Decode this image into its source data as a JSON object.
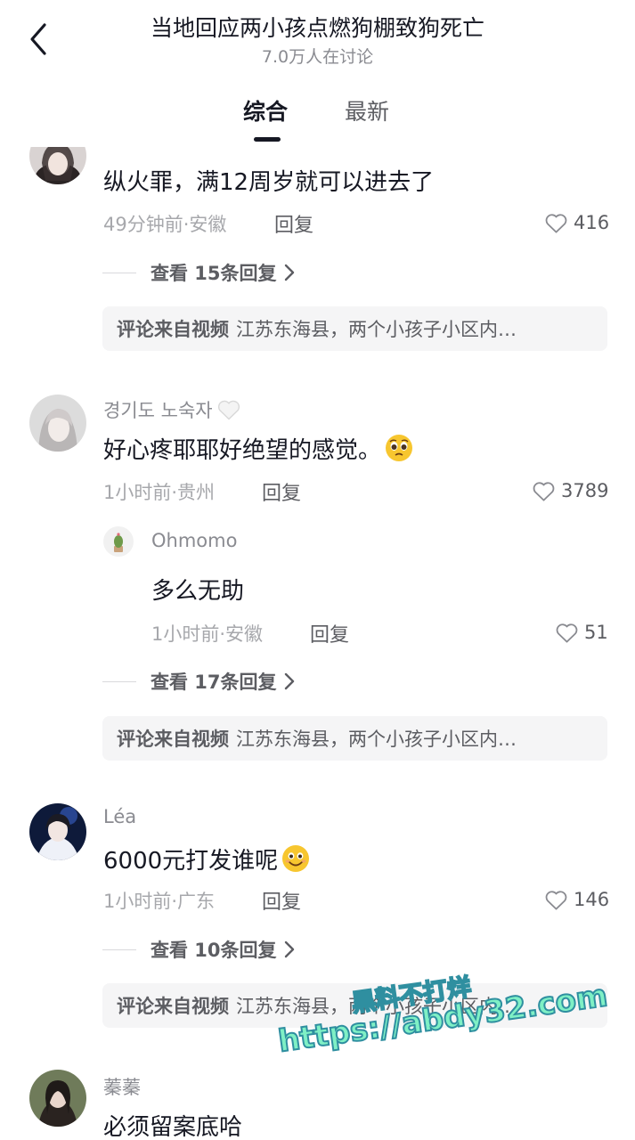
{
  "header": {
    "title": "当地回应两小孩点燃狗棚致狗死亡",
    "subtitle": "7.0万人在讨论"
  },
  "tabs": [
    {
      "label": "综合",
      "active": true
    },
    {
      "label": "最新",
      "active": false
    }
  ],
  "comments": [
    {
      "text": "纵火罪，满12周岁就可以进去了",
      "time_location": "49分钟前·安徽",
      "reply_label": "回复",
      "likes": "416",
      "view_replies": "查看 15条回复",
      "source_label": "评论来自视频",
      "source_text": "江苏东海县，两个小孩子小区内…"
    },
    {
      "username": "경기도 노숙자",
      "username_emoji": "white-heart-icon",
      "text": "好心疼耶耶好绝望的感觉。",
      "text_emoji": "pleading-face-icon",
      "time_location": "1小时前·贵州",
      "reply_label": "回复",
      "likes": "3789",
      "reply": {
        "username": "Ohmomo",
        "text": "多么无助",
        "time_location": "1小时前·安徽",
        "reply_label": "回复",
        "likes": "51"
      },
      "view_replies": "查看 17条回复",
      "source_label": "评论来自视频",
      "source_text": "江苏东海县，两个小孩子小区内…"
    },
    {
      "username": "Léa",
      "text": "6000元打发谁呢",
      "text_emoji": "smiling-face-icon",
      "time_location": "1小时前·广东",
      "reply_label": "回复",
      "likes": "146",
      "view_replies": "查看 10条回复",
      "source_label": "评论来自视频",
      "source_text": "江苏东海县，两个小孩子小区内…"
    },
    {
      "username": "蓁蓁",
      "text": "必须留案底哈"
    }
  ],
  "watermark": {
    "line1": "黑料不打烊",
    "line2": "https://abdy32.com"
  },
  "colors": {
    "primary_text": "#161823",
    "secondary_text": "#8a8b91",
    "meta_text": "#a7a8ac",
    "source_bg": "#f5f5f6",
    "watermark": "#7ff0c5"
  }
}
